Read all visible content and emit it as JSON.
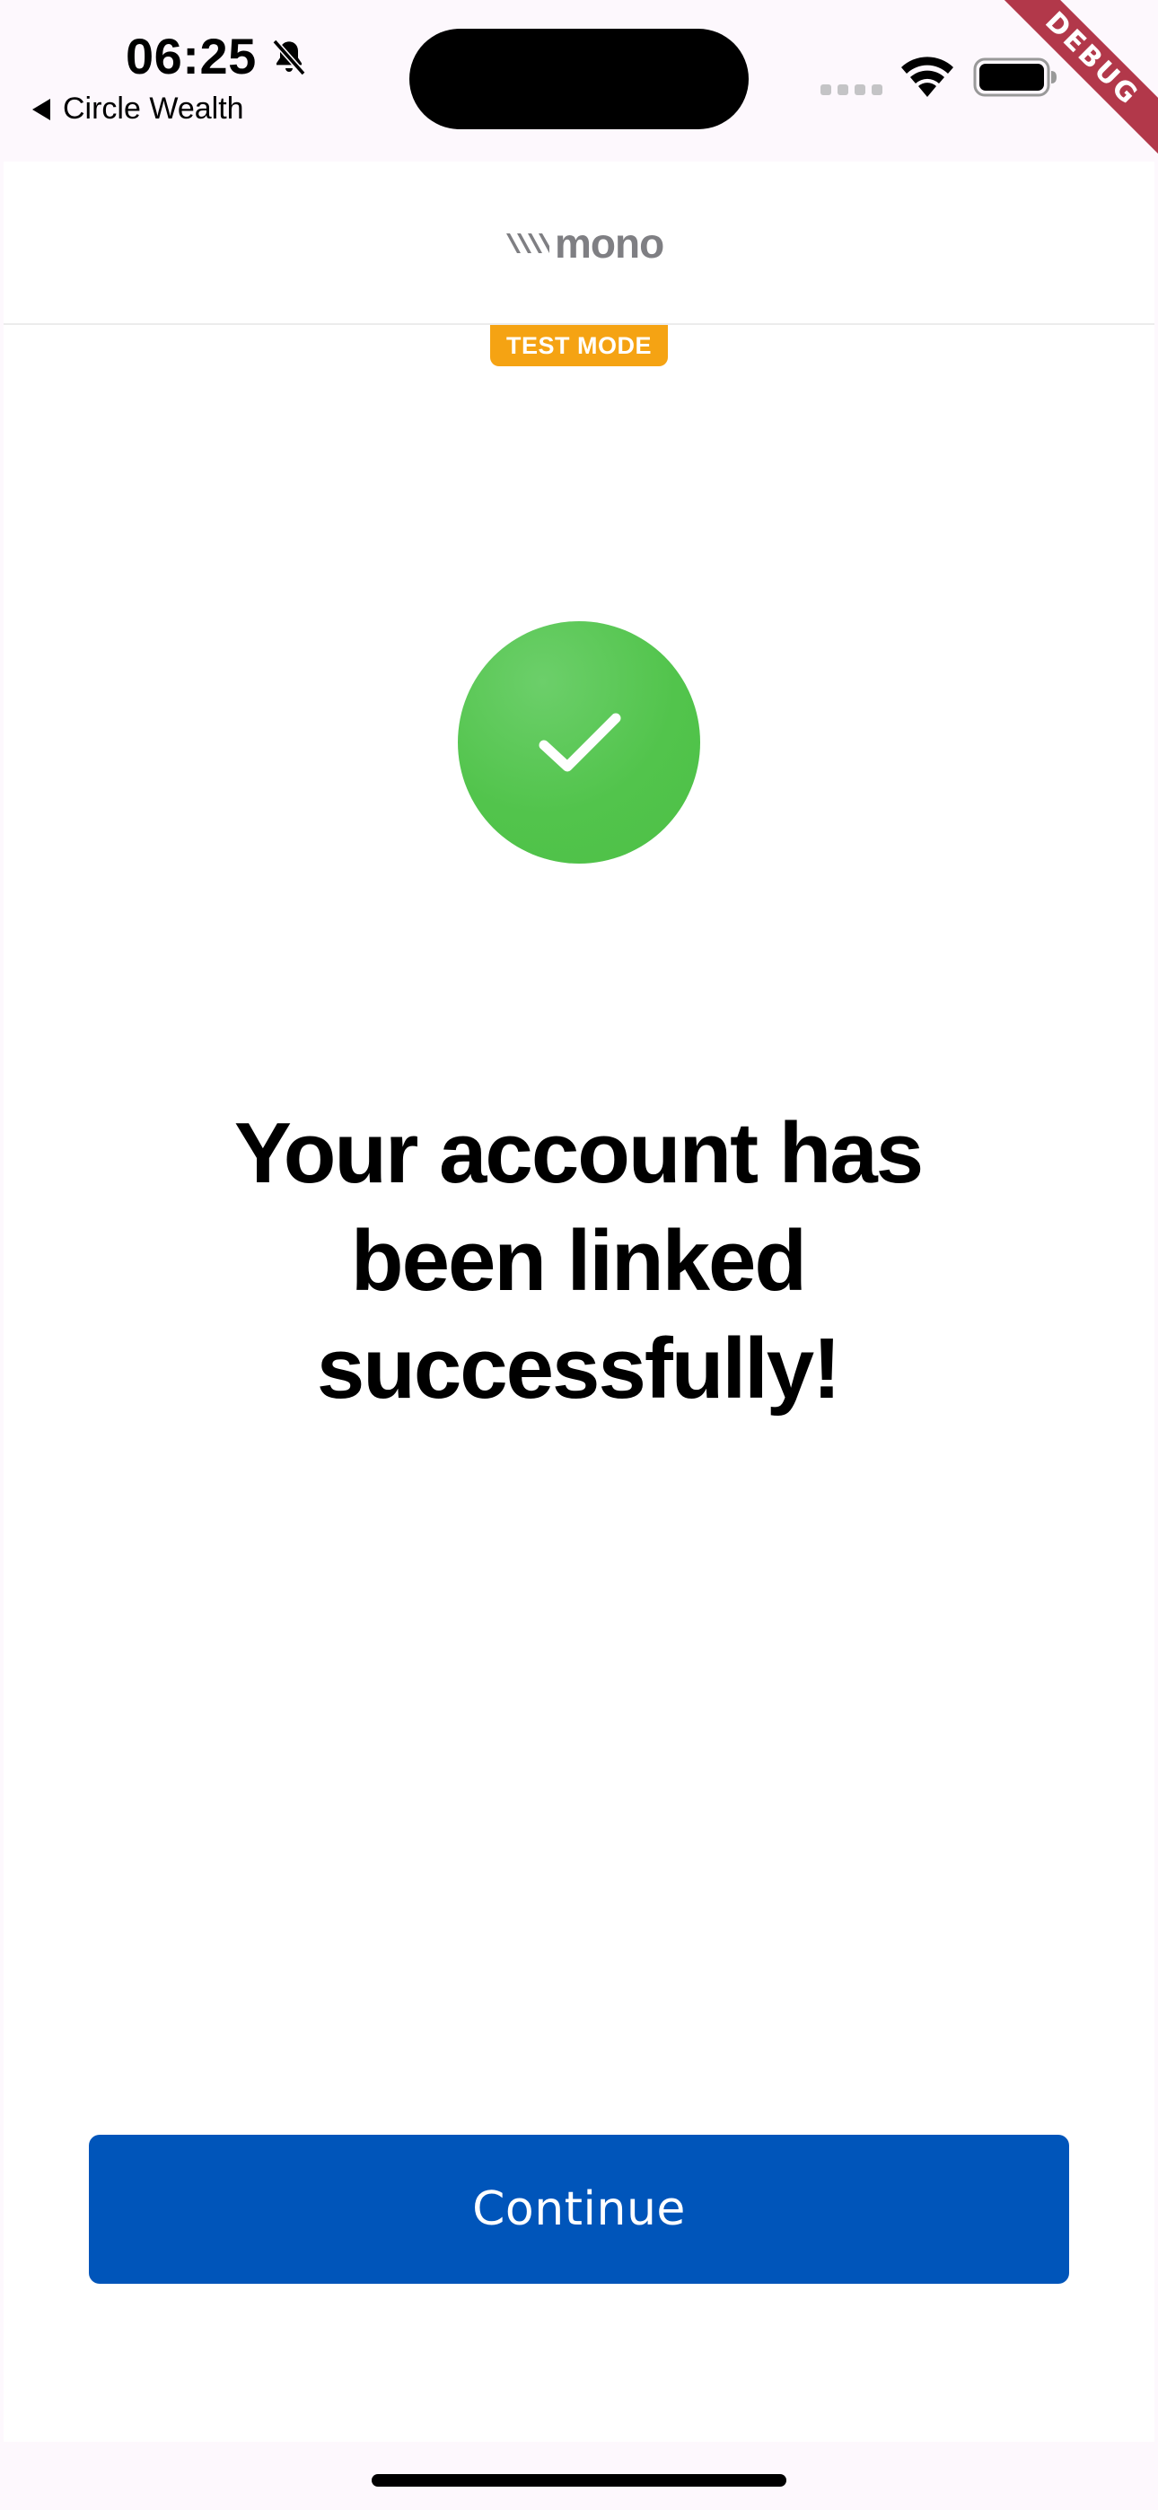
{
  "status_bar": {
    "time": "06:25",
    "back_app_label": "Circle Wealth",
    "icons": [
      "bell-slash-icon",
      "signal-icon",
      "wifi-icon",
      "battery-icon"
    ]
  },
  "debug_banner": {
    "label": "DEBUG",
    "color": "#b2384a"
  },
  "header": {
    "logo_text": "mono",
    "test_mode_label": "TEST MODE",
    "test_mode_color": "#f5a313"
  },
  "main": {
    "status_icon": "checkmark-icon",
    "status_color": "#52c44c",
    "title": "Your account has been linked successfully!"
  },
  "footer": {
    "continue_label": "Continue",
    "button_color": "#0055ba"
  }
}
